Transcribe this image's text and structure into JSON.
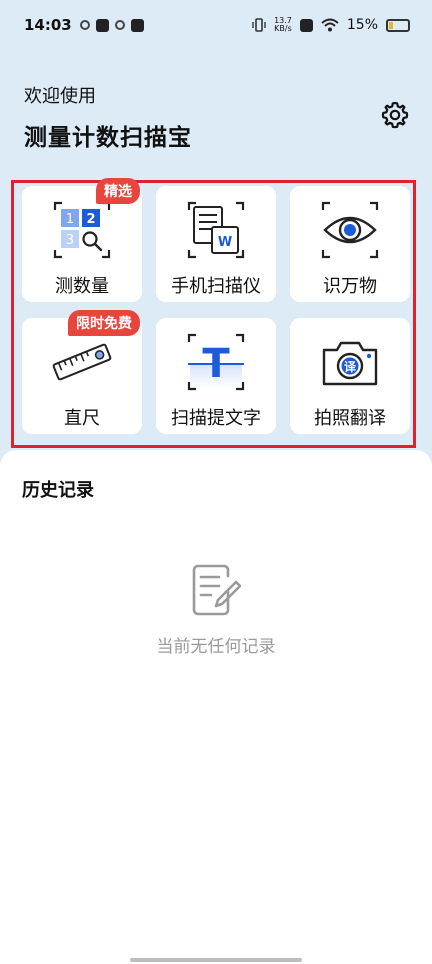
{
  "status_bar": {
    "time": "14:03",
    "net_speed_value": "13.7",
    "net_speed_unit": "KB/s",
    "battery": "15%"
  },
  "header": {
    "welcome": "欢迎使用",
    "app_title": "测量计数扫描宝",
    "settings_icon": "gear-icon"
  },
  "tools": [
    {
      "label": "测数量",
      "badge": "精选",
      "icon": "count-icon"
    },
    {
      "label": "手机扫描仪",
      "badge": "",
      "icon": "document-scan-icon"
    },
    {
      "label": "识万物",
      "badge": "",
      "icon": "eye-icon"
    },
    {
      "label": "直尺",
      "badge": "限时免费",
      "icon": "ruler-icon"
    },
    {
      "label": "扫描提文字",
      "badge": "",
      "icon": "text-scan-icon"
    },
    {
      "label": "拍照翻译",
      "badge": "",
      "icon": "camera-translate-icon"
    }
  ],
  "count_icon_digits": [
    "1",
    "2",
    "3"
  ],
  "word_letter": "W",
  "translate_char": "译",
  "text_scan_char": "T",
  "history": {
    "title": "历史记录",
    "empty_text": "当前无任何记录"
  },
  "colors": {
    "accent": "#1E5BD8",
    "badge": "#E8453C",
    "frame": "#E0212F",
    "background": "#DDEBF7"
  }
}
